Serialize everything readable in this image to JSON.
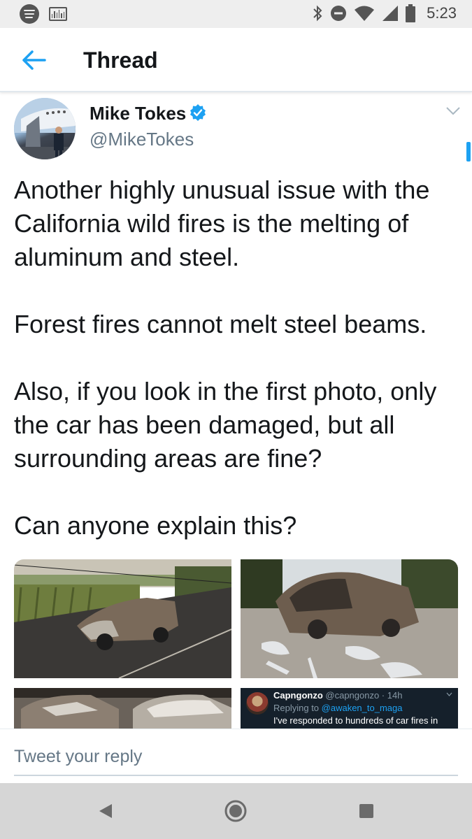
{
  "status_bar": {
    "time": "5:23",
    "icons": [
      "spotify-icon",
      "news-icon",
      "bluetooth-icon",
      "do-not-disturb-icon",
      "wifi-icon",
      "cellular-signal-icon",
      "battery-icon"
    ]
  },
  "header": {
    "title": "Thread",
    "back_icon": "arrow-left-icon"
  },
  "tweet": {
    "author_name": "Mike Tokes",
    "author_handle": "@MikeTokes",
    "verified": true,
    "text": "Another highly unusual issue with the California wild fires is the melting of aluminum and steel.\n\nForest fires cannot melt steel beams.\n\nAlso, if you look in the first photo, only the car has been damaged, but all surrounding areas are fine?\n\nCan anyone explain this?",
    "media": [
      {
        "description": "burned car on road beside vineyard"
      },
      {
        "description": "burned car with melted aluminum puddles"
      },
      {
        "description": "two burned cars"
      },
      {
        "description": "screenshot of reply tweet",
        "screenshot": {
          "user": "Capngonzo",
          "handle": "@capngonzo · 14h",
          "replying_prefix": "Replying to ",
          "replying_handle": "@awaken_to_maga",
          "text": "I've responded to hundreds of car fires in"
        }
      }
    ]
  },
  "reply": {
    "placeholder": "Tweet your reply"
  },
  "nav": {
    "icons": [
      "back-triangle-icon",
      "home-circle-icon",
      "recents-square-icon"
    ]
  },
  "colors": {
    "accent": "#1da1f2",
    "text_primary": "#14171a",
    "text_secondary": "#657786",
    "status_bar_bg": "#eeeeee",
    "nav_bar_bg": "#d6d6d6"
  }
}
